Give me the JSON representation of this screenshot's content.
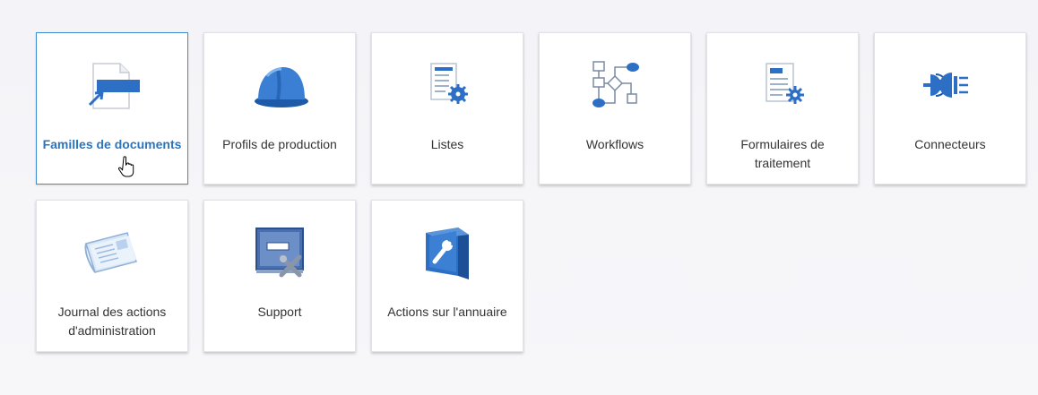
{
  "tiles": [
    {
      "label": "Familles de documents",
      "icon": "document-family-icon",
      "active": true
    },
    {
      "label": "Profils de production",
      "icon": "hard-hat-icon",
      "active": false
    },
    {
      "label": "Listes",
      "icon": "list-settings-icon",
      "active": false
    },
    {
      "label": "Workflows",
      "icon": "workflow-icon",
      "active": false
    },
    {
      "label": "Formulaires de traitement",
      "icon": "form-settings-icon",
      "active": false
    },
    {
      "label": "Connecteurs",
      "icon": "plug-connector-icon",
      "active": false
    },
    {
      "label": "Journal des actions d'administration",
      "icon": "newspaper-icon",
      "active": false
    },
    {
      "label": "Support",
      "icon": "support-tools-icon",
      "active": false
    },
    {
      "label": "Actions sur l'annuaire",
      "icon": "directory-wrench-icon",
      "active": false
    }
  ],
  "colors": {
    "accent": "#2a74c0",
    "icon_blue": "#2d6fc4"
  }
}
